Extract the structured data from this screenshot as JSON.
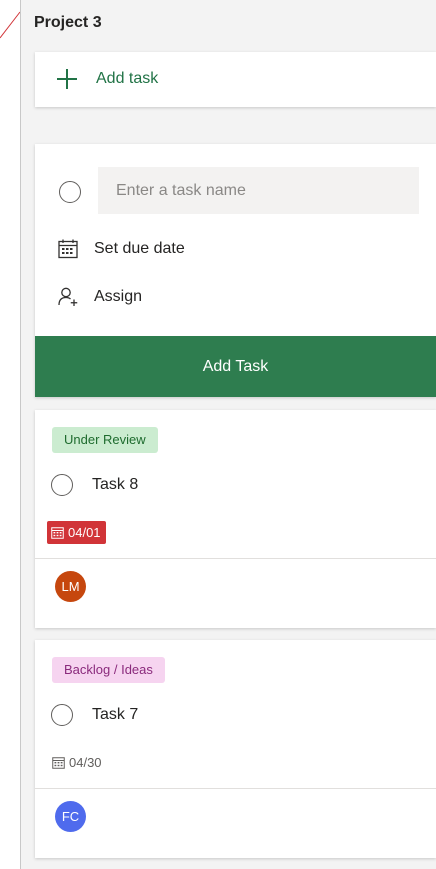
{
  "bucket": {
    "title": "Project 3"
  },
  "add_task_link": {
    "icon": "plus-icon",
    "label": "Add task"
  },
  "new_task_form": {
    "name_placeholder": "Enter a task name",
    "name_value": "",
    "due_date_icon": "calendar-icon",
    "due_date_label": "Set due date",
    "assign_icon": "add-person-icon",
    "assign_label": "Assign",
    "submit_label": "Add Task",
    "submit_color": "#2e7d4f"
  },
  "tasks": [
    {
      "label": "Under Review",
      "label_color": "#cbecd0",
      "title": "Task 8",
      "due": "04/01",
      "overdue": true,
      "due_color": "#d13438",
      "assignee_initials": "LM",
      "assignee_color": "#c6470e"
    },
    {
      "label": "Backlog / Ideas",
      "label_color": "#f6d4f0",
      "title": "Task 7",
      "due": "04/30",
      "overdue": false,
      "assignee_initials": "FC",
      "assignee_color": "#4f6bed"
    }
  ]
}
